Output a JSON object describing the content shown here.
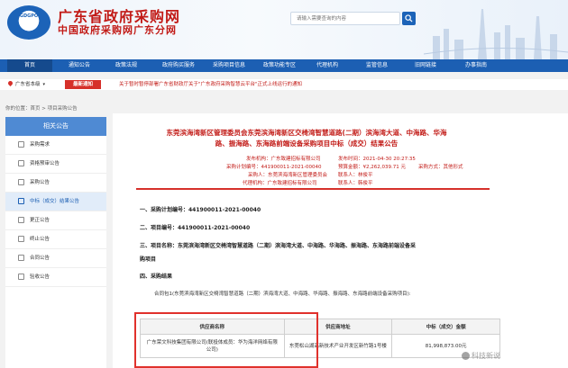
{
  "header": {
    "logo_text": "GDGPO",
    "title": "广东省政府采购网",
    "subtitle": "中国政府采购网广东分网",
    "search_placeholder": "请输入需要查询的内容"
  },
  "nav": {
    "items": [
      "首页",
      "通知公告",
      "政策法规",
      "政府购买服务",
      "采购项目信息",
      "政策功能专区",
      "代理机构",
      "监管信息",
      "旧网链接",
      "办事指南"
    ],
    "active_index": 0
  },
  "notice_bar": {
    "region": "广东省本级",
    "latest_label": "最新通知",
    "text": "关于暂时暂停部署广东省财政厅关于\"广东政府采购智慧云平台\"正式上线运行的通知"
  },
  "breadcrumb": {
    "prefix": "你的位置：",
    "home": "首页",
    "sep": " > ",
    "current": "项目采购公告"
  },
  "sidebar": {
    "title": "相关公告",
    "items": [
      "采购需求",
      "资格预审公告",
      "采购公告",
      "中标（成交）结果公告",
      "更正公告",
      "终止公告",
      "合同公告",
      "验收公告"
    ],
    "active_index": 3
  },
  "document": {
    "title_line1": "东莞滨海湾新区管理委员会东莞滨海湾新区交椅湾智慧道路(二期）滨海湾大道、中海路、华海",
    "title_line2": "路、振海路、东海路前端设备采购项目中标（成交）结果公告",
    "meta": {
      "publisher": "发布机构：广东致建招标有限公司",
      "publish_time": "发布时间：2021-04-30 20:27:35",
      "plan_no": "采购计划编号：441900011-2021-00040",
      "budget": "预算金额：¥2,262,039.71 元",
      "method": "采购方式：其他形式",
      "purchaser": "采购人：东莞滨海湾新区管理委员会",
      "purchaser_contact": "联系人：林俊平",
      "agency": "代理机构：广东致建招标有限公司",
      "agency_contact": "联系人：韩俊平"
    },
    "sections": {
      "s1": "一、采购计划编号：441900011-2021-00040",
      "s2": "二、项目编号：441900011-2021-00040",
      "s3_line1": "三、项目名称：东莞滨海湾新区交椅湾智慧道路（二期）滨海湾大道、中海路、华海路、振海路、东海路前端设备采",
      "s3_line2": "购项目",
      "s4": "四、采购结果",
      "package": "合同包1(东莞滨海湾新区交椅湾智慧道路（二期）滨海湾大道、中海路、华海路、振海路、东海路前端设备采购项目):"
    },
    "table": {
      "headers": [
        "供应商名称",
        "供应商地址",
        "中标（成交）金额"
      ],
      "rows": [
        {
          "supplier": "广东荣文科技集团有限公司(联投体成员：华为海洋网络有限公司)",
          "address": "东莞松山湖高新技术产业开发区新竹路1号楼",
          "amount": "81,998,873.00元"
        }
      ]
    }
  },
  "watermark": "科技新说"
}
